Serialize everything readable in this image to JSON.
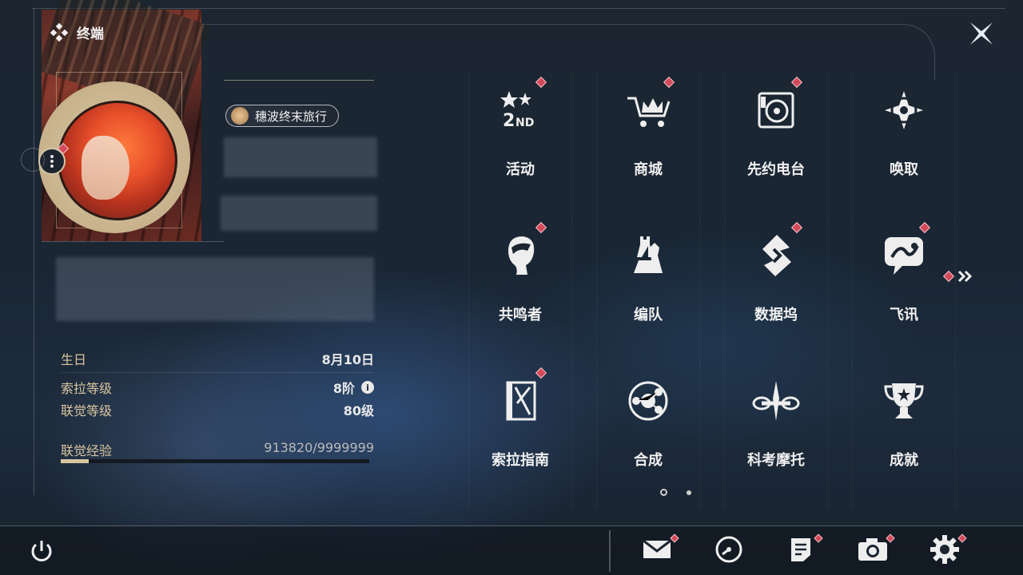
{
  "header": {
    "title": "终端"
  },
  "profile": {
    "badge_label": "穗波终末旅行",
    "stats": [
      {
        "label": "生日",
        "value": "8月10日"
      },
      {
        "label": "索拉等级",
        "value": "8阶"
      },
      {
        "label": "联觉等级",
        "value": "80级"
      }
    ],
    "exp": {
      "label": "联觉经验",
      "value": "913820/9999999",
      "fraction": 0.09
    }
  },
  "grid": {
    "items": [
      {
        "label": "活动",
        "icon": "event-2nd-icon",
        "dot": true
      },
      {
        "label": "商城",
        "icon": "shop-crown-icon",
        "dot": true
      },
      {
        "label": "先约电台",
        "icon": "radio-icon",
        "dot": true
      },
      {
        "label": "唤取",
        "icon": "convene-compass-icon",
        "dot": false
      },
      {
        "label": "共鸣者",
        "icon": "resonator-head-icon",
        "dot": true
      },
      {
        "label": "编队",
        "icon": "team-chess-icon",
        "dot": false
      },
      {
        "label": "数据坞",
        "icon": "data-bank-icon",
        "dot": true
      },
      {
        "label": "飞讯",
        "icon": "messenger-icon",
        "dot": true
      },
      {
        "label": "索拉指南",
        "icon": "guidebook-icon",
        "dot": true
      },
      {
        "label": "合成",
        "icon": "synthesis-icon",
        "dot": false
      },
      {
        "label": "科考摩托",
        "icon": "motorcycle-icon",
        "dot": false
      },
      {
        "label": "成就",
        "icon": "trophy-icon",
        "dot": false
      }
    ]
  },
  "pagination": {
    "current": 1,
    "total": 2
  },
  "bottom_bar": [
    {
      "name": "mail",
      "icon": "mail-icon",
      "dot": true
    },
    {
      "name": "clock",
      "icon": "clock-icon",
      "dot": false
    },
    {
      "name": "notes",
      "icon": "notes-icon",
      "dot": true
    },
    {
      "name": "camera",
      "icon": "camera-icon",
      "dot": true
    },
    {
      "name": "settings",
      "icon": "gear-icon",
      "dot": true
    }
  ],
  "colors": {
    "accent_gold": "#d9c6a0",
    "notify_red": "#d24a5a"
  }
}
